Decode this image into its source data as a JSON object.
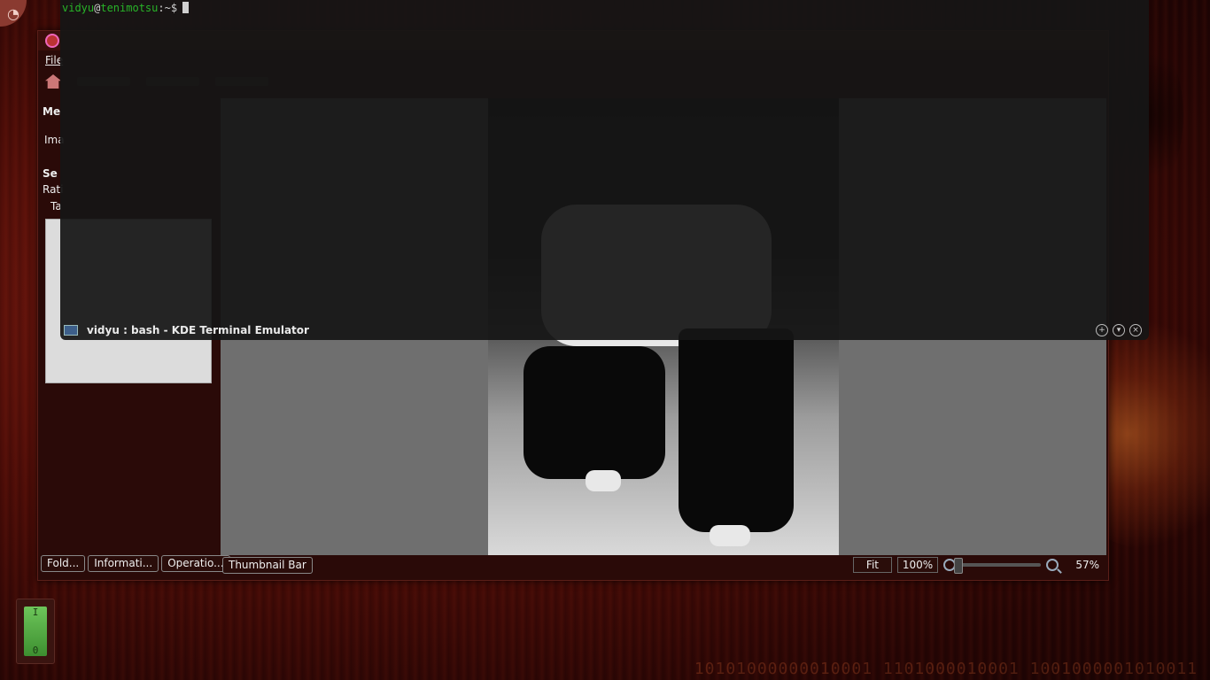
{
  "terminal": {
    "prompt_user": "vidyu",
    "prompt_at": "@",
    "prompt_host": "tenimotsu",
    "prompt_path": ":~$",
    "title": "vidyu : bash - KDE Terminal Emulator",
    "controls": [
      "+",
      "▾",
      "×"
    ]
  },
  "viewer": {
    "menu": [
      "File"
    ],
    "sidebar": {
      "heading1": "Me",
      "label1": "Ima",
      "heading2": "Se",
      "label2": "Rati",
      "label3": "Ta"
    },
    "sidebar_tabs": [
      "Fold...",
      "Informati...",
      "Operatio..."
    ],
    "thumbnail_bar": "Thumbnail Bar",
    "zoom": {
      "fit": "Fit",
      "actual": "100%",
      "current": "57%",
      "level": 0.57
    }
  },
  "desktop": {
    "binary_text": "10101000000010001 1101000010001 1001000001010011",
    "switch_on": "I",
    "switch_off": "0"
  },
  "colors": {
    "prompt_green": "#28b428",
    "wallpaper": "#4a0c07"
  }
}
